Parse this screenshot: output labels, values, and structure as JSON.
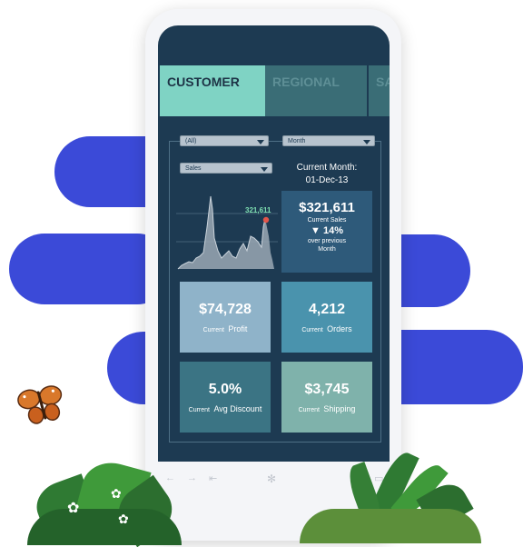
{
  "tabs": [
    "CUSTOMER",
    "REGIONAL",
    "SA"
  ],
  "filters": {
    "segment": "(All)",
    "period": "Month",
    "measure": "Sales"
  },
  "current_month": {
    "label": "Current Month:",
    "value": "01-Dec-13"
  },
  "sparkline": {
    "last_label": "321,611"
  },
  "kpis": {
    "sales": {
      "value": "$321,611",
      "label": "Current Sales",
      "change": "14%",
      "change_note": "over previous Month"
    },
    "profit": {
      "value": "$74,728",
      "label_small": "Current",
      "label_main": "Profit"
    },
    "orders": {
      "value": "4,212",
      "label_small": "Current",
      "label_main": "Orders"
    },
    "discount": {
      "value": "5.0%",
      "label_small": "Current",
      "label_main": "Avg Discount"
    },
    "shipping": {
      "value": "$3,745",
      "label_small": "Current",
      "label_main": "Shipping"
    }
  },
  "colors": {
    "screen_bg": "#1d3a52",
    "tab_active": "#7fd3c4",
    "tab_inactive": "#3a6d76",
    "sales_card": "#2e5a7a",
    "profit_card": "#8fb3c9",
    "orders_card": "#4a93ad",
    "discount_card": "#3b7484",
    "shipping_card": "#7fb2ab",
    "blob": "#3b4ad8"
  }
}
